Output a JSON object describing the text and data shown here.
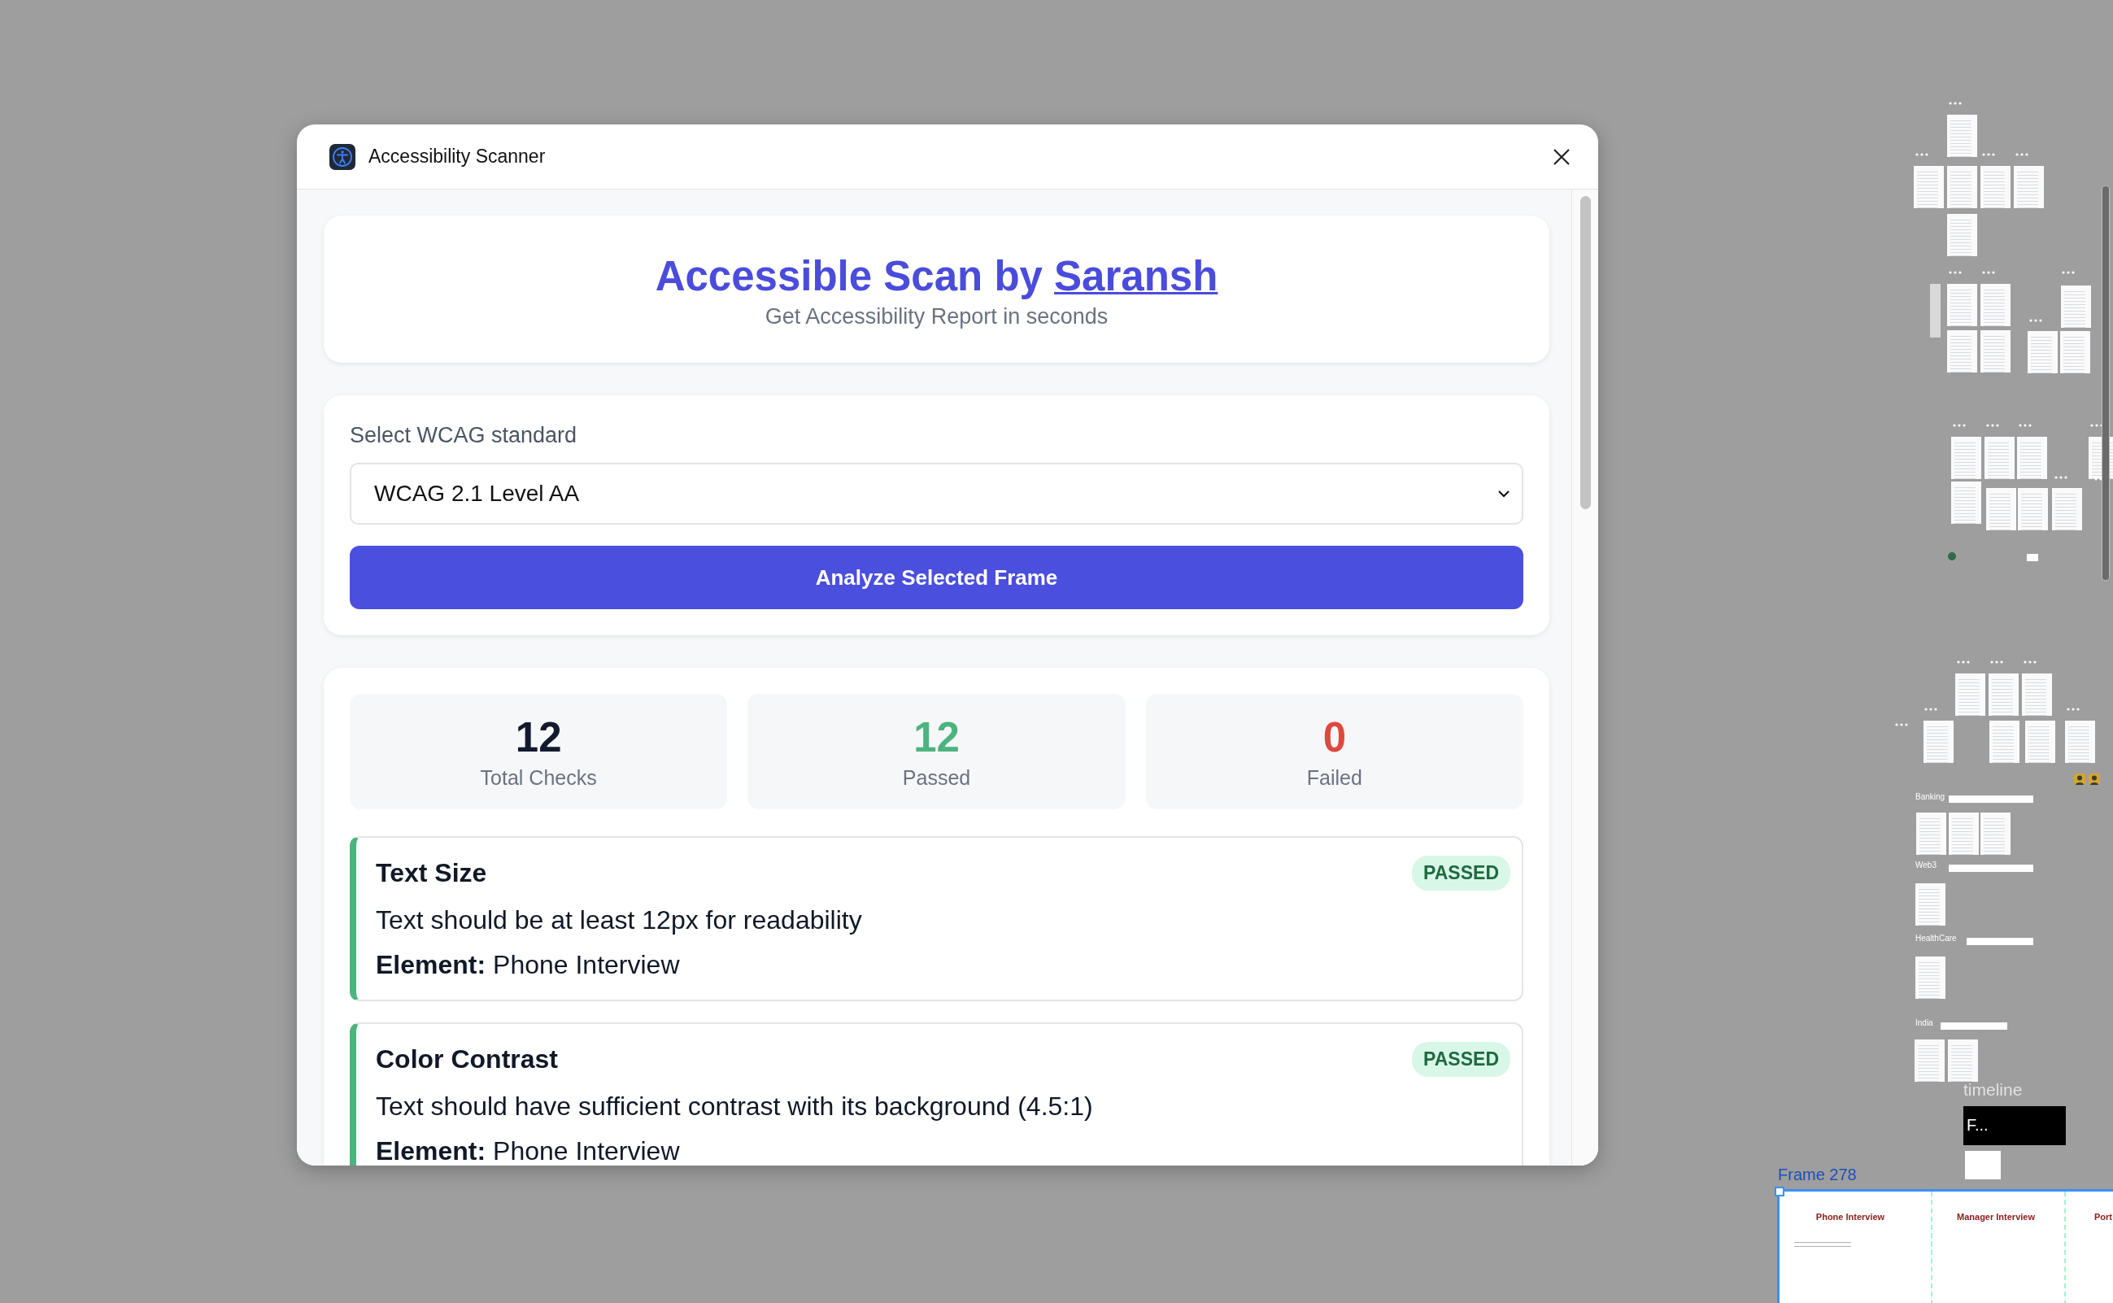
{
  "plugin": {
    "title": "Accessibility Scanner",
    "heading": "Accessible Scan by",
    "author_link": "Saransh",
    "subtitle": "Get Accessibility Report in seconds",
    "standard_label": "Select WCAG standard",
    "standard_value": "WCAG 2.1 Level AA",
    "analyze_button": "Analyze Selected Frame",
    "summary": [
      {
        "kind": "total",
        "value": "12",
        "label": "Total Checks"
      },
      {
        "kind": "passed",
        "value": "12",
        "label": "Passed"
      },
      {
        "kind": "failed",
        "value": "0",
        "label": "Failed"
      }
    ],
    "results": [
      {
        "title": "Text Size",
        "status": "PASSED",
        "passed": true,
        "description": "Text should be at least 12px for readability",
        "element_label": "Element:",
        "element_value": "Phone Interview"
      },
      {
        "title": "Color Contrast",
        "status": "PASSED",
        "passed": true,
        "description": "Text should have sufficient contrast with its background (4.5:1)",
        "element_label": "Element:",
        "element_value": "Phone Interview"
      }
    ]
  },
  "canvas": {
    "sections": [
      {
        "label": "Banking"
      },
      {
        "label": "Web3"
      },
      {
        "label": "HealthCare"
      },
      {
        "label": "India"
      }
    ],
    "timeline_label": "timeline",
    "timeline_thumbnail_text": "F...",
    "frame": {
      "name": "Frame 278",
      "columns": [
        "Phone Interview",
        "Manager Interview",
        "Port"
      ]
    }
  }
}
